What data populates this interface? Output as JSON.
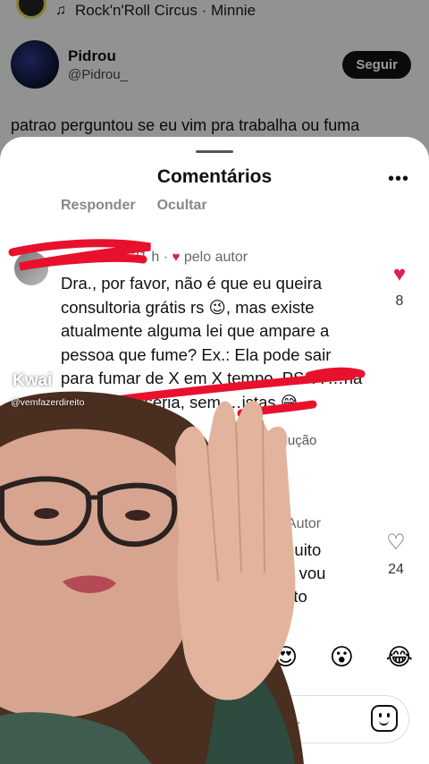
{
  "feed": {
    "music": "Rock'n'Roll Circus · Minnie",
    "user_name": "Pidrou",
    "user_handle": "@Pidrou_",
    "follow_label": "Seguir",
    "post_text": "patrao perguntou se eu vim pra trabalha ou fuma"
  },
  "sheet": {
    "title": "Comentários",
    "more": "•••",
    "prev_reply": "Responder",
    "prev_hide": "Ocultar"
  },
  "comment1": {
    "author": "…ualadez",
    "time": "21 h",
    "separator": "·",
    "author_badge": "pelo autor",
    "body": "Dra., por favor, não é que eu queira consultoria grátis rs 😉, mas existe atualmente alguma lei que ampare a pessoa que fume? Ex.: Ela pode sair para fumar de X em X tempo. PS. A …ha pergunta é séria, sem …istas.😅",
    "likes": "8",
    "translate": "tradução"
  },
  "comment2": {
    "head": "· Autor",
    "body_lines": [
      "muito",
      "a, vou",
      "leto"
    ],
    "likes": "24"
  },
  "emoji_bar": [
    "😍",
    "😮",
    "😂"
  ],
  "input": {
    "placeholder": "o..."
  },
  "watermark": {
    "brand": "Kwai",
    "handle": "@vemfazerdireito"
  },
  "colors": {
    "accent_red": "#e0204a",
    "scribble_red": "#e8112d",
    "button_dark": "#111111"
  }
}
